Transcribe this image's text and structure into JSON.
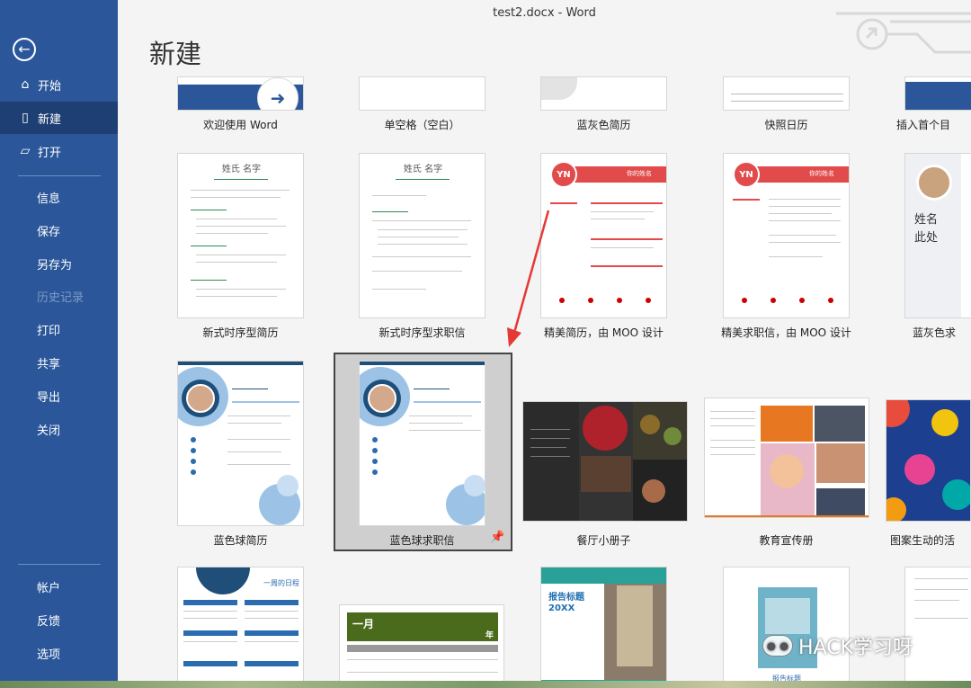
{
  "window": {
    "title": "test2.docx - Word"
  },
  "page": {
    "title": "新建"
  },
  "sidebar": {
    "items": [
      {
        "label": "开始",
        "icon": "home-icon"
      },
      {
        "label": "新建",
        "icon": "new-doc-icon",
        "active": true
      },
      {
        "label": "打开",
        "icon": "folder-open-icon"
      },
      {
        "label": "信息"
      },
      {
        "label": "保存"
      },
      {
        "label": "另存为"
      },
      {
        "label": "历史记录",
        "disabled": true
      },
      {
        "label": "打印"
      },
      {
        "label": "共享"
      },
      {
        "label": "导出"
      },
      {
        "label": "关闭"
      },
      {
        "label": "帐户"
      },
      {
        "label": "反馈"
      },
      {
        "label": "选项"
      }
    ]
  },
  "templates": {
    "row1": [
      "欢迎使用 Word",
      "单空格（空白）",
      "蓝灰色简历",
      "快照日历",
      "插入首个目"
    ],
    "row2": [
      "新式时序型简历",
      "新式时序型求职信",
      "精美简历，由 MOO 设计",
      "精美求职信，由 MOO 设计",
      "蓝灰色求"
    ],
    "row3": [
      "蓝色球简历",
      "蓝色球求职信",
      "餐厅小册子",
      "教育宣传册",
      "图案生动的活"
    ]
  },
  "thumb_text": {
    "name_cn": "姓氏 名字",
    "yn": "YN",
    "your_name": "你的姓名",
    "name_block": "姓名",
    "here": "此处",
    "report_title": "报告标题",
    "report_year": "20XX",
    "month": "一月",
    "year": "年",
    "calendar_title": "一周的日程",
    "report_title2": "报告标题"
  },
  "watermark": {
    "text": "HACK学习呀"
  },
  "colors": {
    "sidebar": "#2b579a",
    "accent_red": "#d9534f",
    "accent_blue": "#2b6cb0"
  }
}
